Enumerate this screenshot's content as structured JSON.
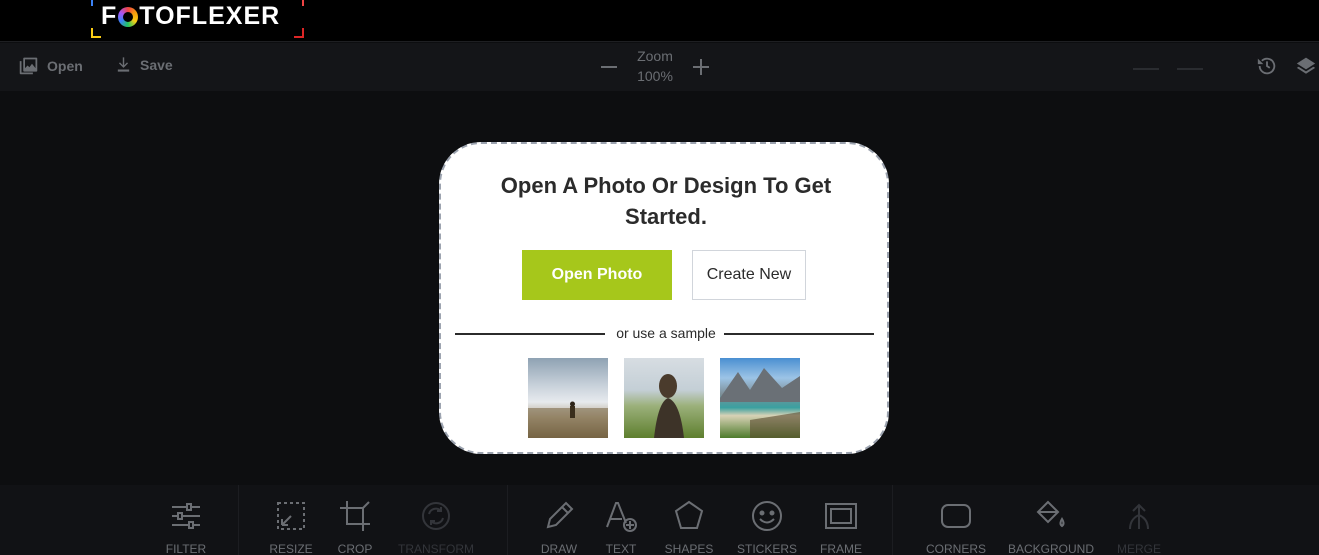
{
  "app": {
    "logo_text_pre": "F",
    "logo_text_post": "TOFLEXER",
    "brand_colors": [
      "#3b82f6",
      "#facc15",
      "#ef4444",
      "#22c55e"
    ]
  },
  "toolbar": {
    "open_label": "Open",
    "save_label": "Save",
    "zoom_label": "Zoom",
    "zoom_value": "100%"
  },
  "modal": {
    "title": "Open A Photo Or Design To Get Started.",
    "open_photo_label": "Open Photo",
    "create_new_label": "Create New",
    "divider_text": "or use a sample",
    "accent_color": "#a6c71b"
  },
  "tools": {
    "filter": "FILTER",
    "resize": "RESIZE",
    "crop": "CROP",
    "transform": "TRANSFORM",
    "draw": "DRAW",
    "text": "TEXT",
    "shapes": "SHAPES",
    "stickers": "STICKERS",
    "frame": "FRAME",
    "corners": "CORNERS",
    "background": "BACKGROUND",
    "merge": "MERGE"
  }
}
